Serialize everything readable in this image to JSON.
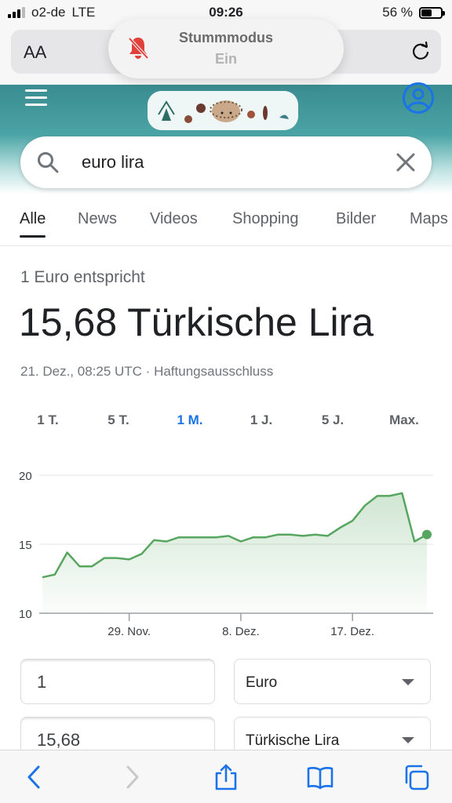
{
  "status_bar": {
    "carrier": "o2-de",
    "network": "LTE",
    "time": "09:26",
    "battery": "56 %"
  },
  "address_bar": {
    "text_size_label": "AA"
  },
  "mute_toast": {
    "title": "Stummmodus",
    "state": "Ein"
  },
  "search": {
    "query": "euro lira"
  },
  "tabs": [
    {
      "label": "Alle",
      "active": true
    },
    {
      "label": "News"
    },
    {
      "label": "Videos"
    },
    {
      "label": "Shopping"
    },
    {
      "label": "Bilder"
    },
    {
      "label": "Maps"
    }
  ],
  "result": {
    "equivalent_label": "1 Euro entspricht",
    "value": "15,68 Türkische Lira",
    "meta": "21. Dez., 08:25 UTC · Haftungsausschluss"
  },
  "ranges": [
    {
      "label": "1 T."
    },
    {
      "label": "5 T."
    },
    {
      "label": "1 M.",
      "active": true
    },
    {
      "label": "1 J."
    },
    {
      "label": "5 J."
    },
    {
      "label": "Max."
    }
  ],
  "chart_data": {
    "type": "area",
    "x_ticks": [
      "29. Nov.",
      "8. Dez.",
      "17. Dez."
    ],
    "y_ticks": [
      "20",
      "15",
      "10"
    ],
    "ylim": [
      10,
      20
    ],
    "values": [
      12.6,
      12.8,
      14.4,
      13.4,
      13.4,
      14.0,
      14.0,
      13.9,
      14.3,
      15.3,
      15.2,
      15.5,
      15.5,
      15.5,
      15.5,
      15.6,
      15.2,
      15.5,
      15.5,
      15.7,
      15.7,
      15.6,
      15.7,
      15.6,
      16.2,
      16.7,
      17.8,
      18.5,
      18.5,
      18.7,
      15.2,
      15.7
    ],
    "line_color": "#57a660",
    "grid": true
  },
  "converter": {
    "amount_from": "1",
    "currency_from": "Euro",
    "amount_to": "15,68",
    "currency_to": "Türkische Lira"
  }
}
